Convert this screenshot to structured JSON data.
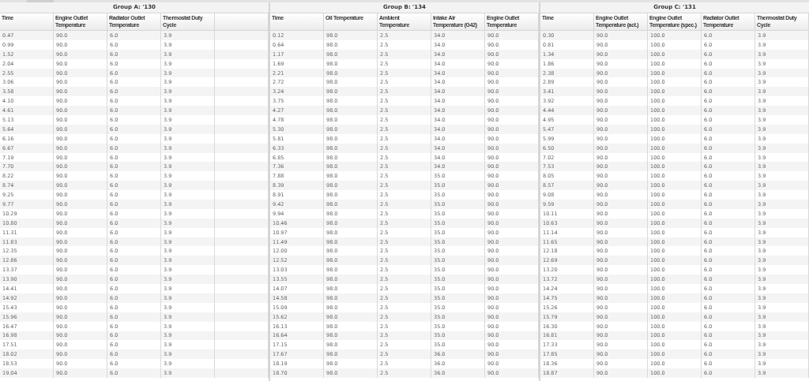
{
  "groups": [
    {
      "title": "Group A: '130",
      "columns": [
        "Time",
        "Engine Outlet Temperature",
        "Radiator Outlet Temperature",
        "Thermostat Duty Cycle"
      ],
      "rows": [
        [
          "0.47",
          "90.0",
          "6.0",
          "3.9"
        ],
        [
          "0.99",
          "90.0",
          "6.0",
          "3.9"
        ],
        [
          "1.52",
          "90.0",
          "6.0",
          "3.9"
        ],
        [
          "2.04",
          "90.0",
          "6.0",
          "3.9"
        ],
        [
          "2.55",
          "90.0",
          "6.0",
          "3.9"
        ],
        [
          "3.06",
          "90.0",
          "6.0",
          "3.9"
        ],
        [
          "3.58",
          "90.0",
          "6.0",
          "3.9"
        ],
        [
          "4.10",
          "90.0",
          "6.0",
          "3.9"
        ],
        [
          "4.61",
          "90.0",
          "6.0",
          "3.9"
        ],
        [
          "5.13",
          "90.0",
          "6.0",
          "3.9"
        ],
        [
          "5.64",
          "90.0",
          "6.0",
          "3.9"
        ],
        [
          "6.16",
          "90.0",
          "6.0",
          "3.9"
        ],
        [
          "6.67",
          "90.0",
          "6.0",
          "3.9"
        ],
        [
          "7.19",
          "90.0",
          "6.0",
          "3.9"
        ],
        [
          "7.70",
          "90.0",
          "6.0",
          "3.9"
        ],
        [
          "8.22",
          "90.0",
          "6.0",
          "3.9"
        ],
        [
          "8.74",
          "90.0",
          "6.0",
          "3.9"
        ],
        [
          "9.25",
          "90.0",
          "6.0",
          "3.9"
        ],
        [
          "9.77",
          "90.0",
          "6.0",
          "3.9"
        ],
        [
          "10.29",
          "90.0",
          "6.0",
          "3.9"
        ],
        [
          "10.80",
          "90.0",
          "6.0",
          "3.9"
        ],
        [
          "11.31",
          "90.0",
          "6.0",
          "3.9"
        ],
        [
          "11.83",
          "90.0",
          "6.0",
          "3.9"
        ],
        [
          "12.35",
          "90.0",
          "6.0",
          "3.9"
        ],
        [
          "12.86",
          "90.0",
          "6.0",
          "3.9"
        ],
        [
          "13.37",
          "90.0",
          "6.0",
          "3.9"
        ],
        [
          "13.90",
          "90.0",
          "6.0",
          "3.9"
        ],
        [
          "14.41",
          "90.0",
          "6.0",
          "3.9"
        ],
        [
          "14.92",
          "90.0",
          "6.0",
          "3.9"
        ],
        [
          "15.43",
          "90.0",
          "6.0",
          "3.9"
        ],
        [
          "15.96",
          "90.0",
          "6.0",
          "3.9"
        ],
        [
          "16.47",
          "90.0",
          "6.0",
          "3.9"
        ],
        [
          "16.98",
          "90.0",
          "6.0",
          "3.9"
        ],
        [
          "17.51",
          "90.0",
          "6.0",
          "3.9"
        ],
        [
          "18.02",
          "90.0",
          "6.0",
          "3.9"
        ],
        [
          "18.53",
          "90.0",
          "6.0",
          "3.9"
        ],
        [
          "19.04",
          "90.0",
          "6.0",
          "3.9"
        ]
      ]
    },
    {
      "title": "Group B: '134",
      "columns": [
        "Time",
        "Oil Temperature",
        "Ambient Temperature",
        "Intake Air Temperature (G42)",
        "Engine Outlet Temperature"
      ],
      "rows": [
        [
          "0.12",
          "98.0",
          "2.5",
          "34.0",
          "90.0"
        ],
        [
          "0.64",
          "98.0",
          "2.5",
          "34.0",
          "90.0"
        ],
        [
          "1.17",
          "98.0",
          "2.5",
          "34.0",
          "90.0"
        ],
        [
          "1.69",
          "98.0",
          "2.5",
          "34.0",
          "90.0"
        ],
        [
          "2.21",
          "98.0",
          "2.5",
          "34.0",
          "90.0"
        ],
        [
          "2.72",
          "98.0",
          "2.5",
          "34.0",
          "90.0"
        ],
        [
          "3.24",
          "98.0",
          "2.5",
          "34.0",
          "90.0"
        ],
        [
          "3.75",
          "98.0",
          "2.5",
          "34.0",
          "90.0"
        ],
        [
          "4.27",
          "98.0",
          "2.5",
          "34.0",
          "90.0"
        ],
        [
          "4.78",
          "98.0",
          "2.5",
          "34.0",
          "90.0"
        ],
        [
          "5.30",
          "98.0",
          "2.5",
          "34.0",
          "90.0"
        ],
        [
          "5.81",
          "98.0",
          "2.5",
          "34.0",
          "90.0"
        ],
        [
          "6.33",
          "98.0",
          "2.5",
          "34.0",
          "90.0"
        ],
        [
          "6.85",
          "98.0",
          "2.5",
          "34.0",
          "90.0"
        ],
        [
          "7.36",
          "98.0",
          "2.5",
          "34.0",
          "90.0"
        ],
        [
          "7.88",
          "98.0",
          "2.5",
          "35.0",
          "90.0"
        ],
        [
          "8.39",
          "98.0",
          "2.5",
          "35.0",
          "90.0"
        ],
        [
          "8.91",
          "98.0",
          "2.5",
          "35.0",
          "90.0"
        ],
        [
          "9.42",
          "98.0",
          "2.5",
          "35.0",
          "90.0"
        ],
        [
          "9.94",
          "98.0",
          "2.5",
          "35.0",
          "90.0"
        ],
        [
          "10.46",
          "98.0",
          "2.5",
          "35.0",
          "90.0"
        ],
        [
          "10.97",
          "98.0",
          "2.5",
          "35.0",
          "90.0"
        ],
        [
          "11.49",
          "98.0",
          "2.5",
          "35.0",
          "90.0"
        ],
        [
          "12.00",
          "98.0",
          "2.5",
          "35.0",
          "90.0"
        ],
        [
          "12.52",
          "98.0",
          "2.5",
          "35.0",
          "90.0"
        ],
        [
          "13.03",
          "98.0",
          "2.5",
          "35.0",
          "90.0"
        ],
        [
          "13.55",
          "98.0",
          "2.5",
          "35.0",
          "90.0"
        ],
        [
          "14.07",
          "98.0",
          "2.5",
          "35.0",
          "90.0"
        ],
        [
          "14.58",
          "98.0",
          "2.5",
          "35.0",
          "90.0"
        ],
        [
          "15.09",
          "98.0",
          "2.5",
          "35.0",
          "90.0"
        ],
        [
          "15.62",
          "98.0",
          "2.5",
          "35.0",
          "90.0"
        ],
        [
          "16.13",
          "98.0",
          "2.5",
          "35.0",
          "90.0"
        ],
        [
          "16.64",
          "98.0",
          "2.5",
          "35.0",
          "90.0"
        ],
        [
          "17.15",
          "98.0",
          "2.5",
          "35.0",
          "90.0"
        ],
        [
          "17.67",
          "98.0",
          "2.5",
          "36.0",
          "90.0"
        ],
        [
          "18.19",
          "98.0",
          "2.5",
          "36.0",
          "90.0"
        ],
        [
          "18.70",
          "98.0",
          "2.5",
          "36.0",
          "90.0"
        ]
      ]
    },
    {
      "title": "Group C: '131",
      "columns": [
        "Time",
        "Engine Outlet Temperature (act.)",
        "Engine Outlet Temperature (spec.)",
        "Radiator Outlet Temperature",
        "Thermostat Duty Cycle"
      ],
      "rows": [
        [
          "0.30",
          "90.0",
          "100.0",
          "6.0",
          "3.9"
        ],
        [
          "0.81",
          "90.0",
          "100.0",
          "6.0",
          "3.9"
        ],
        [
          "1.34",
          "90.0",
          "100.0",
          "6.0",
          "3.9"
        ],
        [
          "1.86",
          "90.0",
          "100.0",
          "6.0",
          "3.9"
        ],
        [
          "2.38",
          "90.0",
          "100.0",
          "6.0",
          "3.9"
        ],
        [
          "2.89",
          "90.0",
          "100.0",
          "6.0",
          "3.9"
        ],
        [
          "3.41",
          "90.0",
          "100.0",
          "6.0",
          "3.9"
        ],
        [
          "3.92",
          "90.0",
          "100.0",
          "6.0",
          "3.9"
        ],
        [
          "4.44",
          "90.0",
          "100.0",
          "6.0",
          "3.9"
        ],
        [
          "4.95",
          "90.0",
          "100.0",
          "6.0",
          "3.9"
        ],
        [
          "5.47",
          "90.0",
          "100.0",
          "6.0",
          "3.9"
        ],
        [
          "5.99",
          "90.0",
          "100.0",
          "6.0",
          "3.9"
        ],
        [
          "6.50",
          "90.0",
          "100.0",
          "6.0",
          "3.9"
        ],
        [
          "7.02",
          "90.0",
          "100.0",
          "6.0",
          "3.9"
        ],
        [
          "7.53",
          "90.0",
          "100.0",
          "6.0",
          "3.9"
        ],
        [
          "8.05",
          "90.0",
          "100.0",
          "6.0",
          "3.9"
        ],
        [
          "8.57",
          "90.0",
          "100.0",
          "6.0",
          "3.9"
        ],
        [
          "9.08",
          "90.0",
          "100.0",
          "6.0",
          "3.9"
        ],
        [
          "9.59",
          "90.0",
          "100.0",
          "6.0",
          "3.9"
        ],
        [
          "10.11",
          "90.0",
          "100.0",
          "6.0",
          "3.9"
        ],
        [
          "10.63",
          "90.0",
          "100.0",
          "6.0",
          "3.9"
        ],
        [
          "11.14",
          "90.0",
          "100.0",
          "6.0",
          "3.9"
        ],
        [
          "11.65",
          "90.0",
          "100.0",
          "6.0",
          "3.9"
        ],
        [
          "12.18",
          "90.0",
          "100.0",
          "6.0",
          "3.9"
        ],
        [
          "12.69",
          "90.0",
          "100.0",
          "6.0",
          "3.9"
        ],
        [
          "13.20",
          "90.0",
          "100.0",
          "6.0",
          "3.9"
        ],
        [
          "13.72",
          "90.0",
          "100.0",
          "6.0",
          "3.9"
        ],
        [
          "14.24",
          "90.0",
          "100.0",
          "6.0",
          "3.9"
        ],
        [
          "14.75",
          "90.0",
          "100.0",
          "6.0",
          "3.9"
        ],
        [
          "15.26",
          "90.0",
          "100.0",
          "6.0",
          "3.9"
        ],
        [
          "15.79",
          "90.0",
          "100.0",
          "6.0",
          "3.9"
        ],
        [
          "16.30",
          "90.0",
          "100.0",
          "6.0",
          "3.9"
        ],
        [
          "16.81",
          "90.0",
          "100.0",
          "6.0",
          "3.9"
        ],
        [
          "17.33",
          "90.0",
          "100.0",
          "6.0",
          "3.9"
        ],
        [
          "17.85",
          "90.0",
          "100.0",
          "6.0",
          "3.9"
        ],
        [
          "18.36",
          "90.0",
          "100.0",
          "6.0",
          "3.9"
        ],
        [
          "18.87",
          "90.0",
          "100.0",
          "6.0",
          "3.9"
        ]
      ]
    }
  ]
}
